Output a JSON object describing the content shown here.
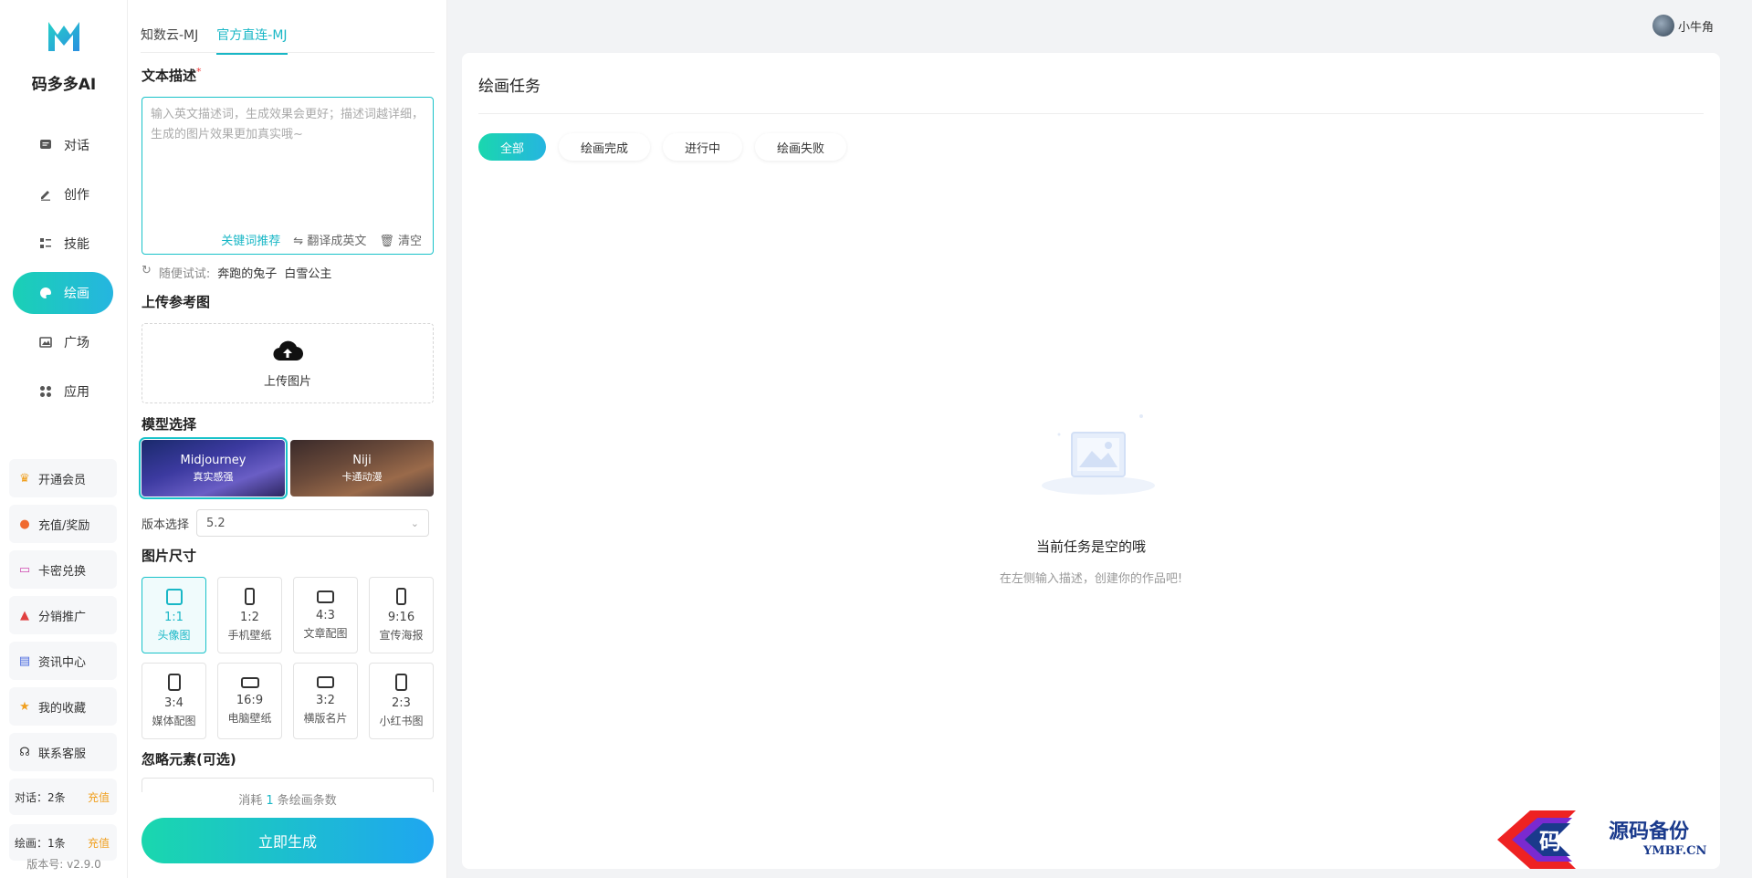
{
  "brand": {
    "name": "码多多AI"
  },
  "nav": {
    "items": [
      {
        "label": "对话",
        "icon": "chat-icon"
      },
      {
        "label": "创作",
        "icon": "pen-icon"
      },
      {
        "label": "技能",
        "icon": "list-icon"
      },
      {
        "label": "绘画",
        "icon": "palette-icon",
        "active": true
      },
      {
        "label": "广场",
        "icon": "image-icon"
      },
      {
        "label": "应用",
        "icon": "apps-icon"
      }
    ],
    "bottom": [
      {
        "label": "开通会员",
        "icon": "crown-icon"
      },
      {
        "label": "充值/奖励",
        "icon": "gift-icon"
      },
      {
        "label": "卡密兑换",
        "icon": "card-icon"
      },
      {
        "label": "分销推广",
        "icon": "share-icon"
      },
      {
        "label": "资讯中心",
        "icon": "news-icon"
      },
      {
        "label": "我的收藏",
        "icon": "star-icon"
      },
      {
        "label": "联系客服",
        "icon": "headset-icon"
      }
    ],
    "quota": [
      {
        "label": "对话：2条",
        "action": "充值"
      },
      {
        "label": "绘画：1条",
        "action": "充值"
      }
    ],
    "version": "版本号: v2.9.0"
  },
  "panel": {
    "tabs": [
      "知数云-MJ",
      "官方直连-MJ"
    ],
    "active_tab": 1,
    "prompt_label": "文本描述",
    "prompt_placeholder": "输入英文描述词，生成效果会更好；描述词越详细，生成的图片效果更加真实哦~",
    "prompt_value": "",
    "actions": {
      "keywords": "关键词推荐",
      "translate": "翻译成英文",
      "clear": "清空"
    },
    "try": {
      "label": "随便试试:",
      "items": [
        "奔跑的兔子",
        "白雪公主"
      ]
    },
    "upload_label": "上传参考图",
    "upload_button": "上传图片",
    "model_label": "模型选择",
    "models": [
      {
        "name": "Midjourney",
        "sub": "真实感强",
        "selected": true
      },
      {
        "name": "Niji",
        "sub": "卡通动漫",
        "selected": false
      }
    ],
    "version_label": "版本选择",
    "version_value": "5.2",
    "size_label": "图片尺寸",
    "ratios": [
      {
        "value": "1:1",
        "label": "头像图",
        "active": true
      },
      {
        "value": "1:2",
        "label": "手机壁纸"
      },
      {
        "value": "4:3",
        "label": "文章配图"
      },
      {
        "value": "9:16",
        "label": "宣传海报"
      },
      {
        "value": "3:4",
        "label": "媒体配图"
      },
      {
        "value": "16:9",
        "label": "电脑壁纸"
      },
      {
        "value": "3:2",
        "label": "横版名片"
      },
      {
        "value": "2:3",
        "label": "小红书图"
      }
    ],
    "negative_label": "忽略元素(可选)",
    "cost": {
      "prefix": "消耗",
      "num": "1",
      "suffix": "条绘画条数"
    },
    "generate_button": "立即生成"
  },
  "user": {
    "name": "小牛角"
  },
  "main": {
    "title": "绘画任务",
    "filters": [
      "全部",
      "绘画完成",
      "进行中",
      "绘画失败"
    ],
    "active_filter": 0,
    "empty_title": "当前任务是空的哦",
    "empty_sub": "在左侧输入描述，创建你的作品吧!"
  },
  "watermark": {
    "text": "源码备份",
    "url": "YMBF.CN",
    "logo_glyph": "码"
  },
  "colors": {
    "accent": "#19b7c6",
    "gradient_start": "#1ad7ae",
    "gradient_end": "#1fa6f0"
  }
}
